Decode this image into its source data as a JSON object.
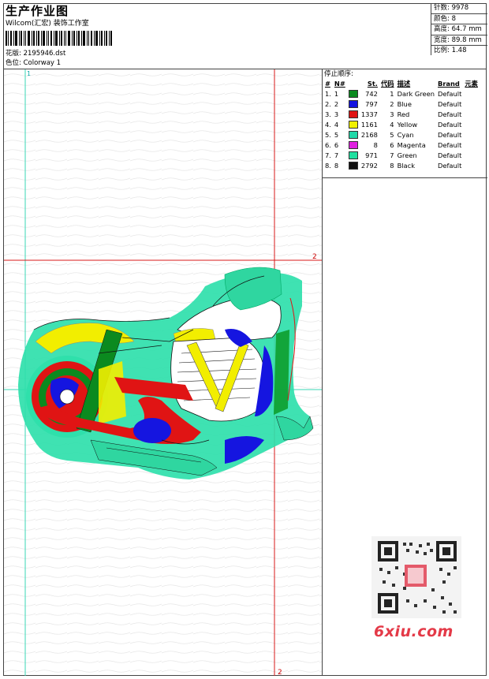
{
  "header": {
    "title": "生产作业图",
    "company": "Wilcom(汇宏) 装饰工作室",
    "design_label": "花版:",
    "design_file": "2195946.dst",
    "colorway_label": "色位:",
    "colorway": "Colorway 1"
  },
  "stats": {
    "stitches": "针数: 9978",
    "colors": "颜色: 8",
    "height": "高度: 64.7 mm",
    "width": "宽度: 89.8 mm",
    "scale": "比例: 1.48"
  },
  "stop_sequence": {
    "title": "停止顺序:",
    "columns": [
      "#",
      "N#",
      "St.",
      "代码",
      "描述",
      "Brand",
      "元素"
    ],
    "rows": [
      {
        "idx": "1.",
        "n": "1",
        "color": "#0b8a1f",
        "st": "742",
        "code": "1",
        "desc": "Dark Green",
        "brand": "Default"
      },
      {
        "idx": "2.",
        "n": "2",
        "color": "#1414e0",
        "st": "797",
        "code": "2",
        "desc": "Blue",
        "brand": "Default"
      },
      {
        "idx": "3.",
        "n": "3",
        "color": "#e01414",
        "st": "1337",
        "code": "3",
        "desc": "Red",
        "brand": "Default"
      },
      {
        "idx": "4.",
        "n": "4",
        "color": "#f0f000",
        "st": "1161",
        "code": "4",
        "desc": "Yellow",
        "brand": "Default"
      },
      {
        "idx": "5.",
        "n": "5",
        "color": "#20d8a8",
        "st": "2168",
        "code": "5",
        "desc": "Cyan",
        "brand": "Default"
      },
      {
        "idx": "6.",
        "n": "6",
        "color": "#e020e0",
        "st": "8",
        "code": "6",
        "desc": "Magenta",
        "brand": "Default"
      },
      {
        "idx": "7.",
        "n": "7",
        "color": "#20e0a0",
        "st": "971",
        "code": "7",
        "desc": "Green",
        "brand": "Default"
      },
      {
        "idx": "8.",
        "n": "8",
        "color": "#101010",
        "st": "2792",
        "code": "8",
        "desc": "Black",
        "brand": "Default"
      }
    ]
  },
  "guides": {
    "h_label": "2",
    "v_label": "2",
    "top_label": "1"
  },
  "watermark": "6xiu.com"
}
